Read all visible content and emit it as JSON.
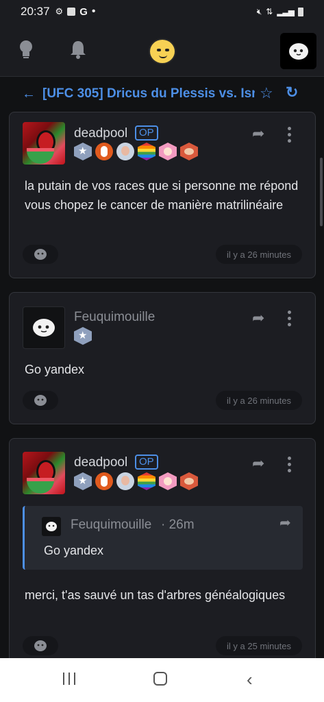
{
  "status_bar": {
    "time": "20:37",
    "left_icons": [
      "gear-icon",
      "image-icon",
      "google-icon",
      "dot-icon"
    ],
    "right_icons": [
      "mute-icon",
      "data-arrows-icon",
      "signal-icon",
      "battery-icon"
    ]
  },
  "appbar": {
    "icons": [
      "lightbulb-icon",
      "bell-icon",
      "smiley-logo-icon",
      "user-avatar-icon"
    ]
  },
  "thread": {
    "back_icon": "←",
    "title": "[UFC 305] Dricus du Plessis vs. Isr",
    "star_icon": "☆",
    "refresh_icon": "↻"
  },
  "posts": [
    {
      "author": "deadpool",
      "op_label": "OP",
      "content": "la putain de vos races que si personne me répond vous chopez le cancer de manière matrilinéaire",
      "time": "il y a 26 minutes",
      "badges": [
        "star-badge",
        "chicken-badge",
        "old-man-badge",
        "rainbow-badge",
        "baby-badge",
        "face-badge"
      ]
    },
    {
      "author": "Feuquimouille",
      "content": "Go yandex",
      "time": "il y a 26 minutes",
      "badges": [
        "star-badge"
      ]
    },
    {
      "author": "deadpool",
      "op_label": "OP",
      "quote": {
        "author": "Feuquimouille",
        "time": "· 26m",
        "text": "Go yandex"
      },
      "content": "merci, t'as sauvé un tas d'arbres généalogiques",
      "time": "il y a 25 minutes",
      "badges": [
        "star-badge",
        "chicken-badge",
        "old-man-badge",
        "rainbow-badge",
        "baby-badge",
        "face-badge"
      ]
    }
  ],
  "nav": {
    "buttons": [
      "recent-apps-button",
      "home-button",
      "back-button"
    ]
  },
  "colors": {
    "background": "#111214",
    "card": "#1c1d22",
    "accent": "#4d8fe6",
    "muted": "#8b8e95"
  }
}
